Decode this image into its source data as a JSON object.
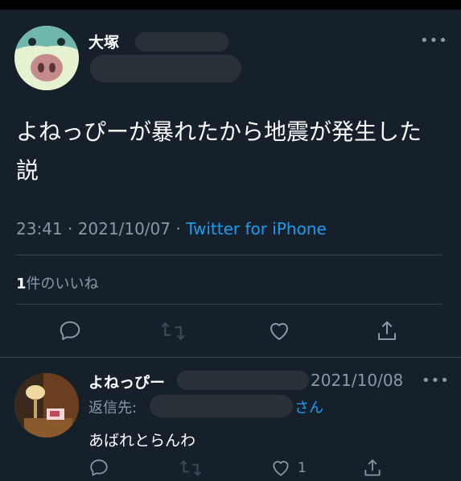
{
  "tweet": {
    "author_name": "大塚",
    "text": "よねっぴーが暴れたから地震が発生した説",
    "time": "23:41 · 2021/10/07 · ",
    "source": "Twitter for iPhone",
    "likes_count": "1",
    "likes_label": "件のいいね"
  },
  "reply": {
    "author_name": "よねっぴー",
    "date": "2021/10/08",
    "reply_to_label": "返信先:",
    "reply_to_suffix": "さん",
    "text": "あばれとらんわ",
    "like_count": "1"
  },
  "icons": [
    "more-icon",
    "reply-icon",
    "retweet-icon",
    "like-icon",
    "share-icon"
  ],
  "colors": {
    "background": "#15202b",
    "link": "#1d9bf0",
    "muted": "#8b98a5"
  }
}
